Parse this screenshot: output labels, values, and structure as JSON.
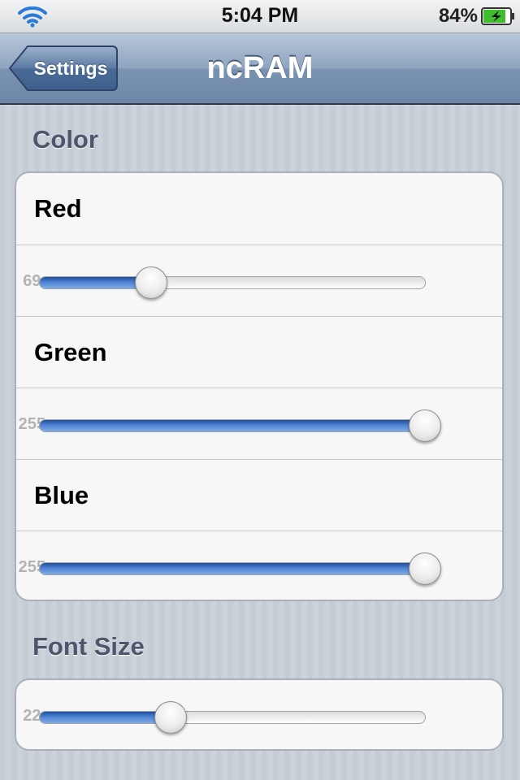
{
  "status_bar": {
    "time": "5:04 PM",
    "battery_percent": "84%",
    "icons": [
      "wifi-icon",
      "battery-charging-icon"
    ]
  },
  "nav_bar": {
    "back_label": "Settings",
    "title": "ncRAM"
  },
  "sections": {
    "color": {
      "header": "Color",
      "rows": [
        {
          "label": "Red",
          "value_label": "69.",
          "value_fraction": 0.29
        },
        {
          "label": "Green",
          "value_label": "255",
          "value_fraction": 1.0
        },
        {
          "label": "Blue",
          "value_label": "255",
          "value_fraction": 1.0
        }
      ]
    },
    "font_size": {
      "header": "Font Size",
      "value_label": "22.",
      "value_fraction": 0.34
    }
  },
  "colors": {
    "nav_bar": "#7b93b1",
    "slider_fill": "#3f73c4",
    "group_bg": "#f7f7f7"
  }
}
